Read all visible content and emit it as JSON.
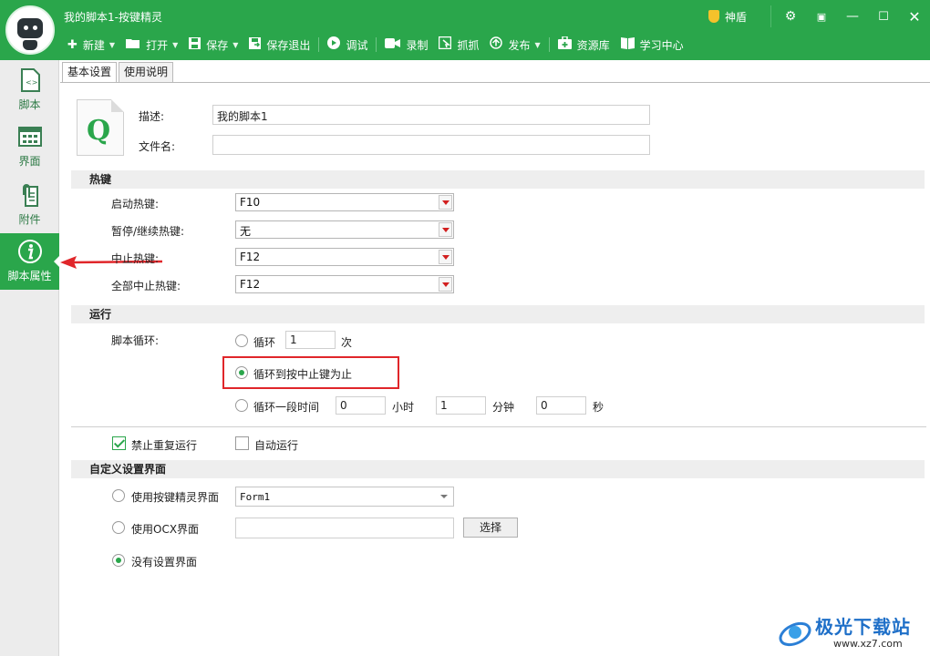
{
  "app": {
    "title": "我的脚本1-按键精灵",
    "shield_label": "神盾"
  },
  "toolbar": {
    "items": [
      {
        "label": "新建",
        "icon": "plus-icon",
        "has_dropdown": true
      },
      {
        "label": "打开",
        "icon": "folder-icon",
        "has_dropdown": true
      },
      {
        "label": "保存",
        "icon": "save-icon",
        "has_dropdown": true
      },
      {
        "label": "保存退出",
        "icon": "save-exit-icon",
        "has_dropdown": false
      },
      {
        "label": "调试",
        "icon": "play-icon",
        "has_dropdown": false
      },
      {
        "label": "录制",
        "icon": "camera-icon",
        "has_dropdown": false
      },
      {
        "label": "抓抓",
        "icon": "grab-icon",
        "has_dropdown": false
      },
      {
        "label": "发布",
        "icon": "publish-icon",
        "has_dropdown": true
      },
      {
        "label": "资源库",
        "icon": "resource-icon",
        "has_dropdown": false
      },
      {
        "label": "学习中心",
        "icon": "book-icon",
        "has_dropdown": false
      }
    ]
  },
  "sidebar": {
    "items": [
      {
        "label": "脚本",
        "icon": "script-file-icon",
        "active": false
      },
      {
        "label": "界面",
        "icon": "layout-grid-icon",
        "active": false
      },
      {
        "label": "附件",
        "icon": "attachment-icon",
        "active": false
      },
      {
        "label": "脚本属性",
        "icon": "info-icon",
        "active": true
      }
    ]
  },
  "tabs": [
    "基本设置",
    "使用说明"
  ],
  "basic": {
    "desc_label": "描述:",
    "desc_value": "我的脚本1",
    "filename_label": "文件名:",
    "filename_value": ""
  },
  "hotkeys": {
    "section_title": "热键",
    "rows": [
      {
        "label": "启动热键:",
        "value": "F10"
      },
      {
        "label": "暂停/继续热键:",
        "value": "无"
      },
      {
        "label": "中止热键:",
        "value": "F12"
      },
      {
        "label": "全部中止热键:",
        "value": "F12"
      }
    ]
  },
  "run": {
    "section_title": "运行",
    "loop_label": "脚本循环:",
    "opt_loop_label": "循环",
    "opt_loop_count": "1",
    "opt_loop_unit": "次",
    "opt_until_label": "循环到按中止键为止",
    "opt_period_label": "循环一段时间",
    "hours_value": "0",
    "hours_unit": "小时",
    "minutes_value": "1",
    "minutes_unit": "分钟",
    "seconds_value": "0",
    "seconds_unit": "秒",
    "selected": "until"
  },
  "options": {
    "no_repeat_label": "禁止重复运行",
    "no_repeat_checked": true,
    "auto_run_label": "自动运行",
    "auto_run_checked": false
  },
  "custom_ui": {
    "section_title": "自定义设置界面",
    "opt_jj_label": "使用按键精灵界面",
    "form_value": "Form1",
    "opt_ocx_label": "使用OCX界面",
    "ocx_value": "",
    "select_button": "选择",
    "opt_none_label": "没有设置界面",
    "selected": "none"
  },
  "watermark": {
    "text": "极光下载站",
    "url": "www.xz7.com"
  },
  "colors": {
    "brand_green": "#2aa64b",
    "highlight_red": "#e0262a"
  }
}
